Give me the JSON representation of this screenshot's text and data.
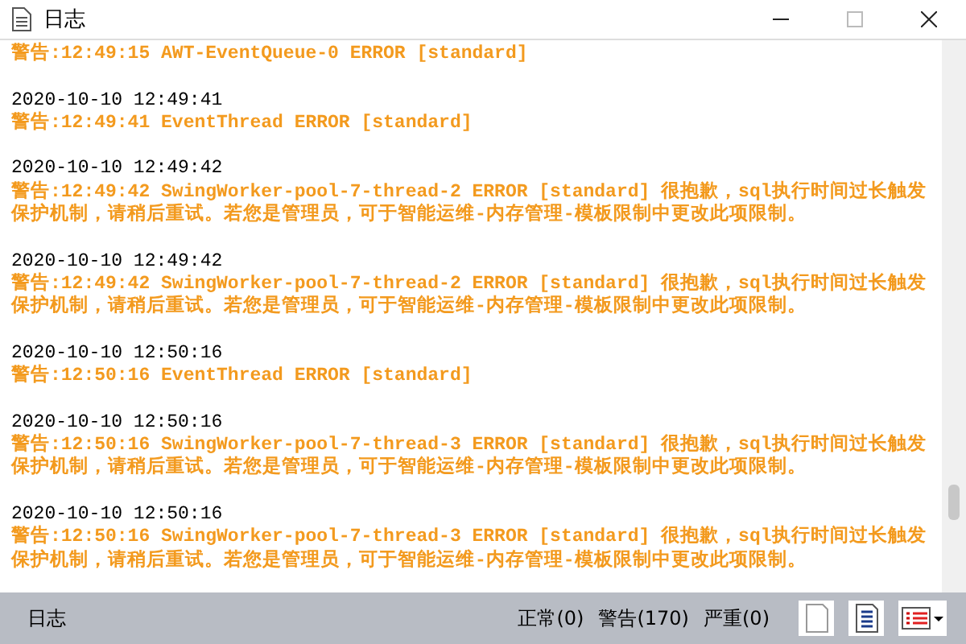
{
  "window": {
    "title": "日志",
    "controls": [
      {
        "kind": "minimize",
        "disabled": false
      },
      {
        "kind": "maximize",
        "disabled": true
      },
      {
        "kind": "close",
        "disabled": false
      }
    ]
  },
  "log": [
    {
      "message": "警告:12:49:15 AWT-EventQueue-0 ERROR [standard]"
    },
    {
      "date": "2020-10-10 12:49:41",
      "message": "警告:12:49:41 EventThread ERROR [standard]"
    },
    {
      "date": "2020-10-10 12:49:42",
      "message": "警告:12:49:42 SwingWorker-pool-7-thread-2 ERROR [standard] 很抱歉，sql执行时间过长触发保护机制，请稍后重试。若您是管理员，可于智能运维-内存管理-模板限制中更改此项限制。"
    },
    {
      "date": "2020-10-10 12:49:42",
      "message": "警告:12:49:42 SwingWorker-pool-7-thread-2 ERROR [standard] 很抱歉，sql执行时间过长触发保护机制，请稍后重试。若您是管理员，可于智能运维-内存管理-模板限制中更改此项限制。"
    },
    {
      "date": "2020-10-10 12:50:16",
      "message": "警告:12:50:16 EventThread ERROR [standard]"
    },
    {
      "date": "2020-10-10 12:50:16",
      "message": "警告:12:50:16 SwingWorker-pool-7-thread-3 ERROR [standard] 很抱歉，sql执行时间过长触发保护机制，请稍后重试。若您是管理员，可于智能运维-内存管理-模板限制中更改此项限制。"
    },
    {
      "date": "2020-10-10 12:50:16",
      "message": "警告:12:50:16 SwingWorker-pool-7-thread-3 ERROR [standard] 很抱歉，sql执行时间过长触发保护机制，请稍后重试。若您是管理员，可于智能运维-内存管理-模板限制中更改此项限制。"
    }
  ],
  "status_bar": {
    "label": "日志",
    "counts": [
      "正常(0)",
      "警告(170)",
      "严重(0)"
    ],
    "tools": [
      {
        "kind": "blank-page"
      },
      {
        "kind": "lined-page"
      },
      {
        "kind": "list-dropdown"
      }
    ]
  }
}
